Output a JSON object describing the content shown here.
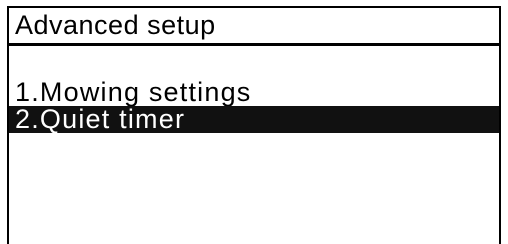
{
  "header": {
    "title": "Advanced setup"
  },
  "menu": {
    "items": [
      {
        "label": "1.Mowing settings",
        "selected": false
      },
      {
        "label": "2.Quiet timer",
        "selected": true
      }
    ]
  },
  "colors": {
    "foreground": "#000000",
    "background": "#ffffff",
    "selection_background": "#111111",
    "selection_text": "#ffffff"
  }
}
